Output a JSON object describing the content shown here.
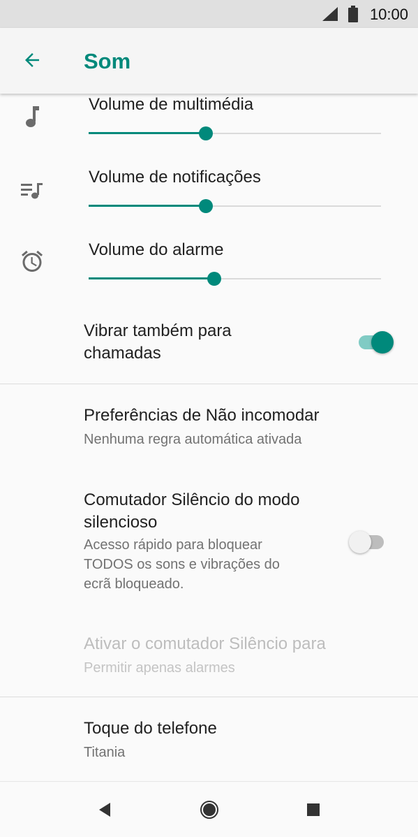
{
  "status_bar": {
    "time": "10:00"
  },
  "app_bar": {
    "title": "Som"
  },
  "volumes": [
    {
      "title": "Volume de multimédia",
      "icon": "music-note-icon",
      "level": 0.4
    },
    {
      "title": "Volume de notificações",
      "icon": "playlist-icon",
      "level": 0.4
    },
    {
      "title": "Volume do alarme",
      "icon": "alarm-clock-icon",
      "level": 0.43
    }
  ],
  "vibrate": {
    "title_line1": "Vibrar também para",
    "title_line2": "chamadas",
    "enabled": true
  },
  "do_not_disturb": {
    "title": "Preferências de Não incomodar",
    "summary": "Nenhuma regra automática ativada"
  },
  "silence_switch": {
    "title_line1": "Comutador Silêncio do modo",
    "title_line2": "silencioso",
    "summary_line1": "Acesso rápido para bloquear",
    "summary_line2": "TODOS os sons e vibrações do",
    "summary_line3": "ecrã bloqueado.",
    "enabled": false
  },
  "silence_target": {
    "title": "Ativar o comutador Silêncio para",
    "summary": "Permitir apenas alarmes",
    "disabled": true
  },
  "ringtone": {
    "title": "Toque do telefone",
    "summary": "Titania"
  },
  "colors": {
    "accent": "#00897b",
    "accent_light": "#80cbc4",
    "status_bar": "#e0e0e0"
  }
}
